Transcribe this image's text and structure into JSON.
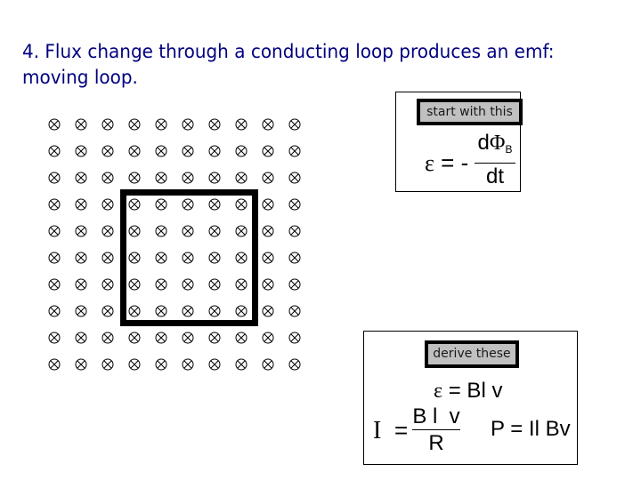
{
  "slide": {
    "title_line1": "4. Flux change through a conducting loop produces an emf:",
    "title_line2": "moving loop.",
    "title_color": "#000080"
  },
  "field": {
    "symbol": "circle-cross (field into page)",
    "rows": 10,
    "cols": 10
  },
  "loop": {
    "description": "rectangular conducting loop",
    "color": "#000000",
    "spans_cols": [
      3,
      7
    ],
    "spans_rows": [
      3,
      7
    ]
  },
  "start_box": {
    "label": "start with this",
    "equation": {
      "lhs": "ε",
      "equals": "=",
      "sign": "-",
      "numerator_d": "d",
      "numerator_phi": "Φ",
      "numerator_sub": "B",
      "denominator": "dt"
    }
  },
  "derive_box": {
    "label": "derive these",
    "emf_equation": "ε = Bl v",
    "emf_lhs": "ε",
    "emf_rhs": "= Bl v",
    "current_lhs": "I",
    "current_equals": "=",
    "current_numerator": "B l  v",
    "current_denominator": "R",
    "power_equation": "P = Il Bv"
  },
  "colors": {
    "label_fill": "#c0c0c0",
    "label_border": "#000000",
    "box_border": "#000000"
  }
}
